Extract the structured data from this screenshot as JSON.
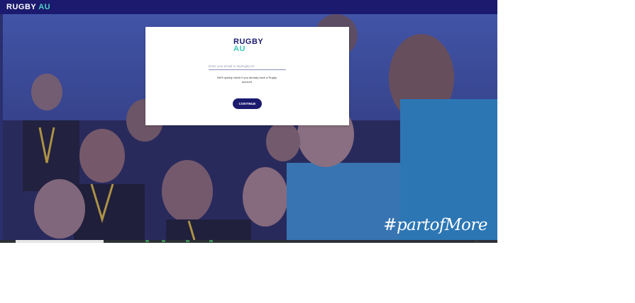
{
  "topbar": {
    "brand_left": "RUGBY",
    "brand_right": "AU"
  },
  "login": {
    "logo_line1": "RUGBY",
    "logo_line2": "AU",
    "email_placeholder": "Enter your Email or MyRugby ID",
    "helper_text": "We'll quickly check if you already have a Rugby account",
    "continue_label": "CONTINUE"
  },
  "hero": {
    "hashtag": "#partofMore"
  },
  "taskbar": {
    "tray_text": "::: :::"
  },
  "colors": {
    "navy": "#1b1a6e",
    "teal": "#3ec7b8",
    "jersey_blue": "#2f8fc8",
    "white": "#ffffff"
  }
}
